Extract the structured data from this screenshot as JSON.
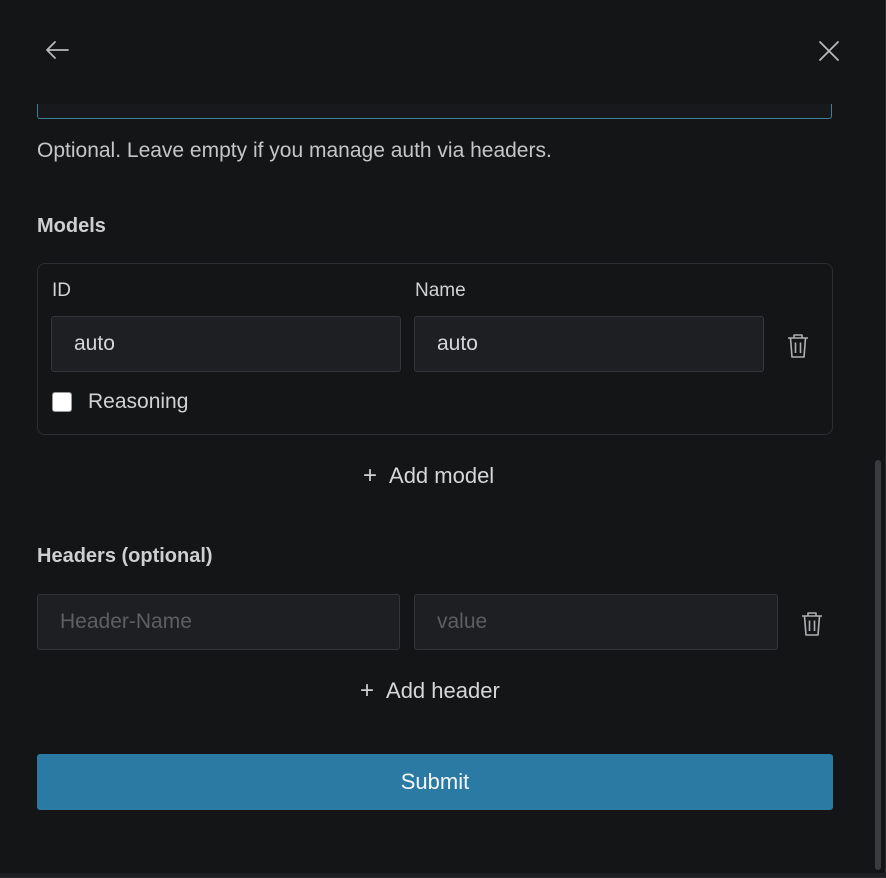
{
  "hint_text": "Optional. Leave empty if you manage auth via headers.",
  "models": {
    "title": "Models",
    "id_label": "ID",
    "name_label": "Name",
    "id_value": "auto",
    "name_value": "auto",
    "reasoning_label": "Reasoning",
    "reasoning_checked": false,
    "add_label": "Add model"
  },
  "headers": {
    "title": "Headers (optional)",
    "name_placeholder": "Header-Name",
    "value_placeholder": "value",
    "add_label": "Add header"
  },
  "submit_label": "Submit",
  "icons": {
    "back": "arrow-left-icon",
    "close": "close-icon",
    "delete": "trash-icon",
    "add": "plus-icon"
  },
  "colors": {
    "background": "#141517",
    "accent": "#2a7aa3",
    "input_bg": "#1d1f22"
  }
}
